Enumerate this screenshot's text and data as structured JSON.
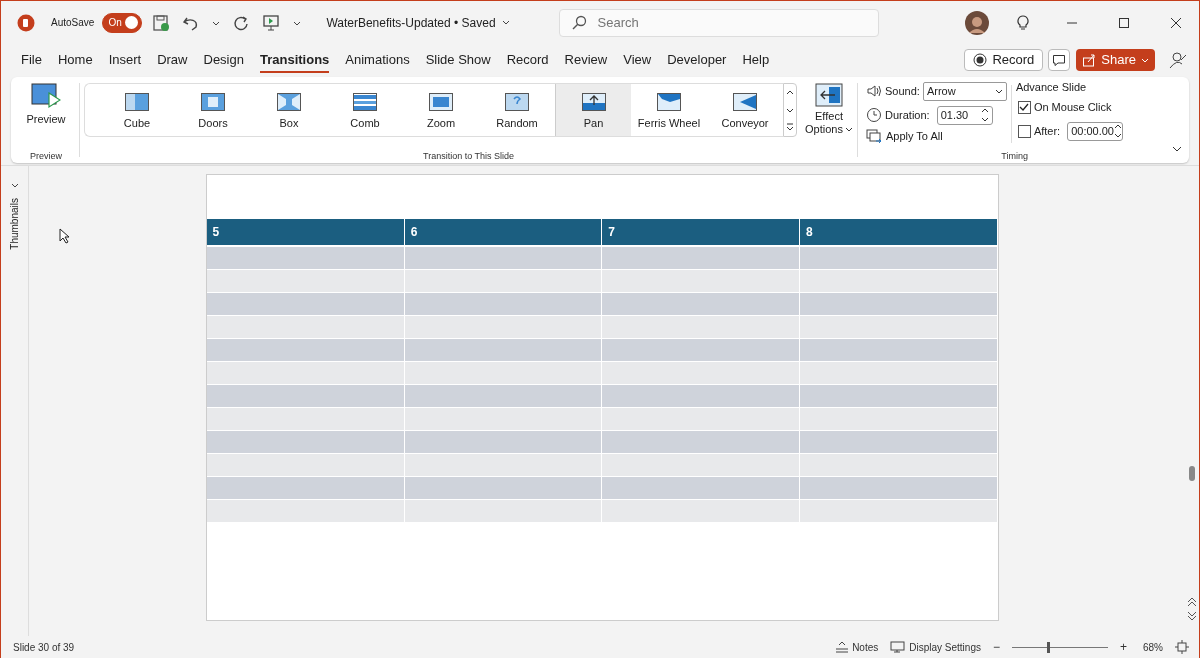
{
  "title_bar": {
    "autosave_label": "AutoSave",
    "autosave_toggle": {
      "label": "On",
      "on": true
    },
    "document_title": "WaterBenefits-Updated • Saved",
    "search": {
      "placeholder": "Search"
    }
  },
  "tabs": [
    {
      "label": "File",
      "selected": false
    },
    {
      "label": "Home",
      "selected": false
    },
    {
      "label": "Insert",
      "selected": false
    },
    {
      "label": "Draw",
      "selected": false
    },
    {
      "label": "Design",
      "selected": false
    },
    {
      "label": "Transitions",
      "selected": true
    },
    {
      "label": "Animations",
      "selected": false
    },
    {
      "label": "Slide Show",
      "selected": false
    },
    {
      "label": "Record",
      "selected": false
    },
    {
      "label": "Review",
      "selected": false
    },
    {
      "label": "View",
      "selected": false
    },
    {
      "label": "Developer",
      "selected": false
    },
    {
      "label": "Help",
      "selected": false
    }
  ],
  "header_buttons": {
    "record": "Record",
    "share": "Share"
  },
  "ribbon": {
    "preview_group": {
      "button": "Preview",
      "label": "Preview"
    },
    "gallery": {
      "label": "Transition to This Slide",
      "items": [
        {
          "label": "Cube",
          "selected": false
        },
        {
          "label": "Doors",
          "selected": false
        },
        {
          "label": "Box",
          "selected": false
        },
        {
          "label": "Comb",
          "selected": false
        },
        {
          "label": "Zoom",
          "selected": false
        },
        {
          "label": "Random",
          "selected": false
        },
        {
          "label": "Pan",
          "selected": true
        },
        {
          "label": "Ferris Wheel",
          "selected": false
        },
        {
          "label": "Conveyor",
          "selected": false
        }
      ]
    },
    "effect_options": [
      "Effect",
      "Options"
    ],
    "timing": {
      "label": "Timing",
      "sound_label": "Sound:",
      "sound_value": "Arrow",
      "duration_label": "Duration:",
      "duration_value": "01.30",
      "apply_all": "Apply To All",
      "advance_title": "Advance Slide",
      "on_mouse_click": {
        "label": "On Mouse Click",
        "checked": true
      },
      "after": {
        "label": "After:",
        "checked": false,
        "value": "00:00.00"
      }
    }
  },
  "thumbnails_pane": {
    "label": "Thumbnails"
  },
  "slide": {
    "table": {
      "columns": [
        "5",
        "6",
        "7",
        "8"
      ],
      "rows": [
        {
          "kind": "band"
        },
        {
          "kind": "plain"
        },
        {
          "kind": "band"
        },
        {
          "kind": "plain"
        },
        {
          "kind": "band"
        },
        {
          "kind": "plain"
        },
        {
          "kind": "band"
        },
        {
          "kind": "plain"
        },
        {
          "kind": "band"
        },
        {
          "kind": "plain"
        },
        {
          "kind": "band"
        },
        {
          "kind": "plain"
        }
      ]
    }
  },
  "status_bar": {
    "slide_count": "Slide 30 of 39",
    "notes": "Notes",
    "display_settings": "Display Settings",
    "zoom_minus": "−",
    "zoom_plus": "+",
    "zoom_level": {
      "level": 0.36
    },
    "zoom_percent": "68%"
  }
}
